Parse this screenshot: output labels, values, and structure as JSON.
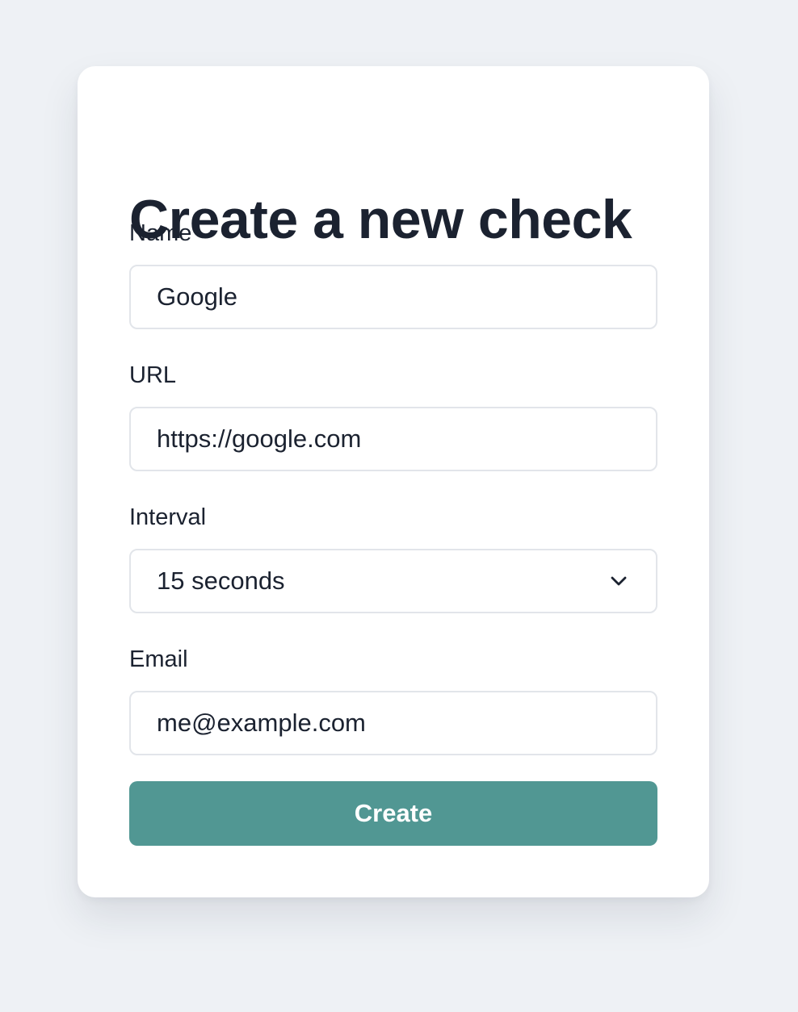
{
  "form": {
    "title": "Create a new check",
    "name_label": "Name",
    "name_value": "Google",
    "url_label": "URL",
    "url_value": "https://google.com",
    "interval_label": "Interval",
    "interval_value": "15 seconds",
    "email_label": "Email",
    "email_value": "me@example.com",
    "create_label": "Create"
  },
  "icons": {
    "interval_chevron": "chevron-down-icon"
  },
  "colors": {
    "background": "#eef1f5",
    "card": "#ffffff",
    "text": "#1b2230",
    "input_border": "#e2e5ea",
    "button": "#519793",
    "button_text": "#ffffff"
  }
}
